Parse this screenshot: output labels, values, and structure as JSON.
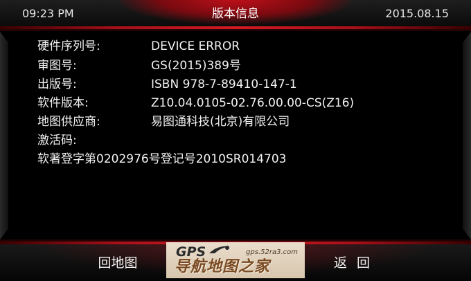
{
  "status_bar": {
    "time": "09:23 PM",
    "title": "版本信息",
    "date": "2015.08.15"
  },
  "info_rows": [
    {
      "label": "硬件序列号:",
      "value": "DEVICE ERROR"
    },
    {
      "label": "审图号:",
      "value": "GS(2015)389号"
    },
    {
      "label": "出版号:",
      "value": "ISBN 978-7-89410-147-1"
    },
    {
      "label": "软件版本:",
      "value": "Z10.04.0105-02.76.00.00-CS(Z16)"
    },
    {
      "label": "地图供应商:",
      "value": "易图通科技(北京)有限公司"
    },
    {
      "label": "激活码:",
      "value": ""
    }
  ],
  "registration": "软著登字第0202976号登记号2010SR014703",
  "footer": {
    "map_button": "回地图",
    "back_button": "返 回"
  },
  "watermark": {
    "brand": "GPS",
    "url": "gps.52ra3.com",
    "title": "导航地图之家"
  },
  "colors": {
    "accent": "#d41a22",
    "background": "#000000",
    "text": "#f2f2f2"
  }
}
